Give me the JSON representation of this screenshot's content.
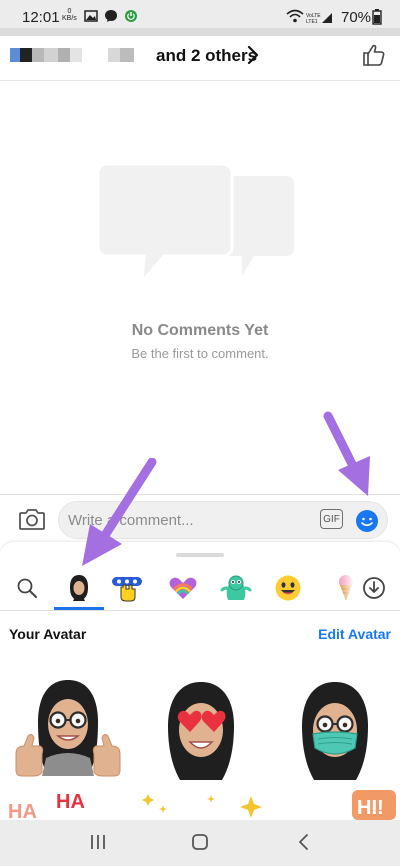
{
  "status_bar": {
    "time": "12:01",
    "small_text": "0\nKB/s",
    "battery": "70%"
  },
  "header": {
    "title": "and 2 others"
  },
  "empty_state": {
    "title": "No Comments Yet",
    "subtitle": "Be the first to comment."
  },
  "composer": {
    "placeholder": "Write a comment...",
    "visible_text": "Write a comment...",
    "gif_label": "GIF"
  },
  "sticker_panel": {
    "tabs": [
      {
        "name": "search-icon",
        "active": false
      },
      {
        "name": "avatar-tab",
        "active": true
      },
      {
        "name": "hand-sticker-tab",
        "active": false
      },
      {
        "name": "heart-sticker-tab",
        "active": false
      },
      {
        "name": "creature-sticker-tab",
        "active": false
      },
      {
        "name": "emoji-face-tab",
        "active": false
      },
      {
        "name": "icecream-sticker-tab",
        "active": false
      },
      {
        "name": "download-icon",
        "active": false
      }
    ],
    "section_title": "Your Avatar",
    "edit_label": "Edit Avatar",
    "stickers_row1": [
      "avatar-thumbs-up",
      "avatar-heart-eyes",
      "avatar-mask"
    ],
    "stickers_row2_text": [
      "HA",
      "HA",
      "HI!"
    ]
  },
  "colors": {
    "accent": "#1877f2",
    "arrow": "#a46fe0",
    "hijab": "#1f1f1f",
    "skin": "#e0b28f"
  }
}
